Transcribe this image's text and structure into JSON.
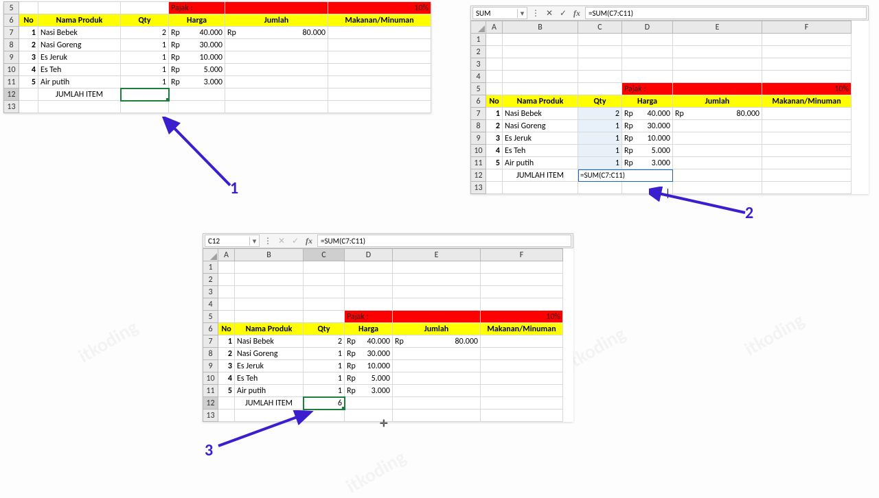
{
  "watermark_text": "itkoding",
  "pajak_label": "Pajak :",
  "pajak_pct": "10%",
  "columns": [
    "A",
    "B",
    "C",
    "D",
    "E",
    "F"
  ],
  "headers": {
    "no": "No",
    "nama": "Nama Produk",
    "qty": "Qty",
    "harga": "Harga",
    "jumlah": "Jumlah",
    "makmin": "Makanan/Minuman"
  },
  "chart_data": {
    "type": "table",
    "columns": [
      "No",
      "Nama Produk",
      "Qty",
      "Harga"
    ],
    "rows": [
      {
        "no": 1,
        "nama": "Nasi Bebek",
        "qty": 2,
        "harga_currency": "Rp",
        "harga": "40.000"
      },
      {
        "no": 2,
        "nama": "Nasi Goreng",
        "qty": 1,
        "harga_currency": "Rp",
        "harga": "30.000"
      },
      {
        "no": 3,
        "nama": "Es Jeruk",
        "qty": 1,
        "harga_currency": "Rp",
        "harga": "10.000"
      },
      {
        "no": 4,
        "nama": "Es Teh",
        "qty": 1,
        "harga_currency": "Rp",
        "harga": "5.000"
      },
      {
        "no": 5,
        "nama": "Air putih",
        "qty": 1,
        "harga_currency": "Rp",
        "harga": "3.000"
      }
    ],
    "jumlah_first": {
      "currency": "Rp",
      "value": "80.000"
    },
    "jumlah_item_label": "JUMLAH ITEM",
    "sum_result": "6",
    "formula": "=SUM(C7:C11)"
  },
  "panel1": {
    "row_labels": [
      "5",
      "6",
      "7",
      "8",
      "9",
      "10",
      "11",
      "12",
      "13"
    ],
    "selected_cell": "C12"
  },
  "panel2": {
    "namebox": "SUM",
    "formula_bar": "=SUM(C7:C11)",
    "row_labels": [
      "1",
      "2",
      "3",
      "4",
      "5",
      "6",
      "7",
      "8",
      "9",
      "10",
      "11",
      "12",
      "13"
    ],
    "cell_edit": "=SUM(C7:C11)"
  },
  "panel3": {
    "namebox": "C12",
    "formula_bar": "=SUM(C7:C11)",
    "row_labels": [
      "1",
      "2",
      "3",
      "4",
      "5",
      "6",
      "7",
      "8",
      "9",
      "10",
      "11",
      "12",
      "13"
    ],
    "result": "6"
  },
  "annotations": {
    "a1": "1",
    "a2": "2",
    "a3": "3"
  }
}
